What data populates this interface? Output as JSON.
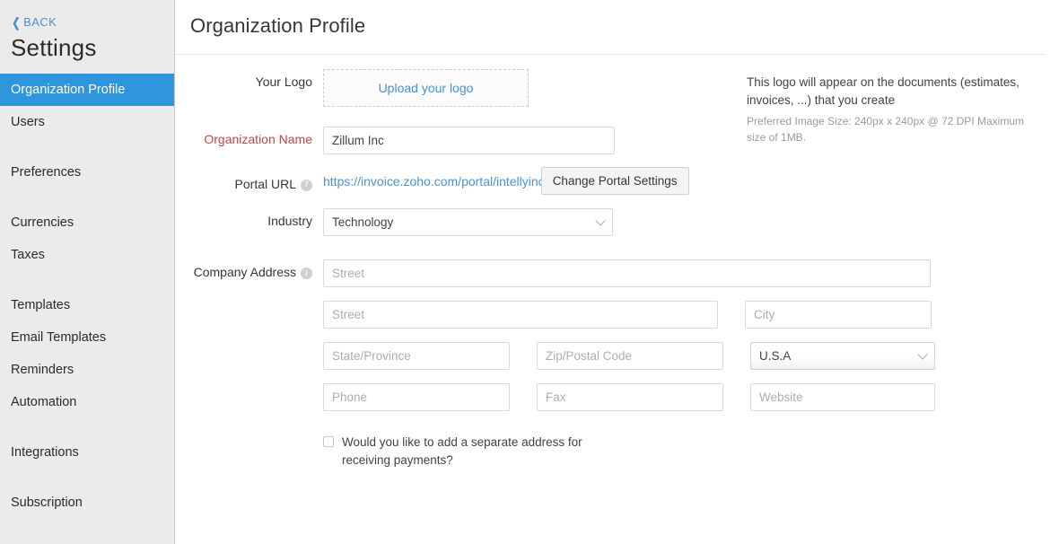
{
  "sidebar": {
    "back_label": "BACK",
    "back_icon": "chevron-left-icon",
    "title": "Settings",
    "groups": [
      {
        "items": [
          {
            "label": "Organization Profile",
            "active": true
          },
          {
            "label": "Users",
            "active": false
          }
        ]
      },
      {
        "items": [
          {
            "label": "Preferences",
            "active": false
          }
        ]
      },
      {
        "items": [
          {
            "label": "Currencies",
            "active": false
          },
          {
            "label": "Taxes",
            "active": false
          }
        ]
      },
      {
        "items": [
          {
            "label": "Templates",
            "active": false
          },
          {
            "label": "Email Templates",
            "active": false
          },
          {
            "label": "Reminders",
            "active": false
          },
          {
            "label": "Automation",
            "active": false
          }
        ]
      },
      {
        "items": [
          {
            "label": "Integrations",
            "active": false
          }
        ]
      },
      {
        "items": [
          {
            "label": "Subscription",
            "active": false
          }
        ]
      }
    ]
  },
  "page": {
    "title": "Organization Profile"
  },
  "form": {
    "logo": {
      "label": "Your Logo",
      "upload_text": "Upload your logo",
      "note_main": "This logo will appear on the documents (estimates, invoices, ...) that you create",
      "note_sub": "Preferred Image Size: 240px x 240px @ 72 DPI Maximum size of 1MB."
    },
    "org_name": {
      "label": "Organization Name",
      "value": "Zillum Inc",
      "placeholder": ""
    },
    "portal_url": {
      "label": "Portal URL",
      "help_icon": "question-mark-icon",
      "url": "https://invoice.zoho.com/portal/intellyinc",
      "button_label": "Change Portal Settings"
    },
    "industry": {
      "label": "Industry",
      "value": "Technology",
      "chevron_icon": "chevron-down-icon"
    },
    "company_address": {
      "label": "Company Address",
      "help_icon": "info-icon",
      "street1_placeholder": "Street",
      "street2_placeholder": "Street",
      "city_placeholder": "City",
      "state_placeholder": "State/Province",
      "zip_placeholder": "Zip/Postal Code",
      "country_value": "U.S.A",
      "country_chevron_icon": "chevron-down-icon",
      "phone_placeholder": "Phone",
      "fax_placeholder": "Fax",
      "website_placeholder": "Website"
    },
    "separate_address": {
      "checked": false,
      "label": "Would you like to add a separate address for receiving payments?"
    }
  },
  "colors": {
    "accent_blue": "#2f96dd",
    "link_blue": "#4a90d9",
    "required_red": "#b94a48",
    "sidebar_bg": "#ebebeb"
  }
}
